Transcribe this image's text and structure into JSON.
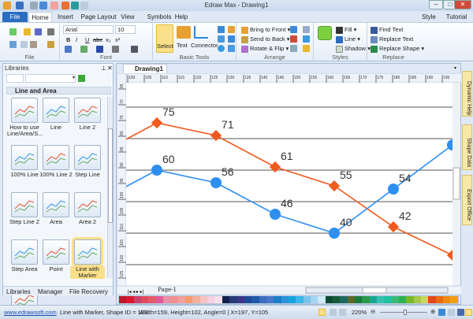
{
  "window": {
    "title": "Edraw Max - Drawing1",
    "style": "Style",
    "tutorial": "Tutorial"
  },
  "tabs": [
    "File",
    "Home",
    "Insert",
    "Page Layout",
    "View",
    "Symbols",
    "Help"
  ],
  "ribbon": {
    "file_group": "File",
    "font": {
      "name": "Arial",
      "size": "10",
      "label": "Font",
      "bold": "B",
      "italic": "I",
      "underline": "U",
      "strike": "abc",
      "sub": "x₂",
      "sup": "x²"
    },
    "basic_tools": {
      "label": "Basic Tools",
      "select": "Select",
      "text": "Text",
      "connector": "Connector"
    },
    "arrange": {
      "label": "Arrange",
      "bring_front": "Bring to Front",
      "send_back": "Send to Back",
      "rotate": "Rotate & Flip"
    },
    "styles": {
      "label": "Styles",
      "fill": "Fill",
      "line": "Line",
      "shadow": "Shadow"
    },
    "replace": {
      "label": "Replace",
      "find": "Find Text",
      "replace_text": "Replace Text",
      "replace_shape": "Replace Shape"
    }
  },
  "libraries": {
    "title": "Libraries",
    "category": "Line and Area",
    "items": [
      "How to use Line/Area/S...",
      "Line",
      "Line 2",
      "100% Line",
      "100% Line 2",
      "Step Line",
      "Step Line 2",
      "Area",
      "Area 2",
      "Step Area",
      "Point",
      "Line with Marker",
      ""
    ],
    "selected": "Line with Marker",
    "bottom_tabs": [
      "Libraries",
      "Manager",
      "File Recovery"
    ]
  },
  "document_tab": "Drawing1",
  "ruler": {
    "h": [
      "100",
      "105",
      "110",
      "115",
      "120",
      "125",
      "130",
      "135",
      "140",
      "145",
      "150",
      "155",
      "160",
      "165",
      "170",
      "175",
      "180",
      "185",
      "190",
      "195"
    ],
    "v": [
      "65",
      "70",
      "75",
      "80",
      "85",
      "90",
      "95",
      "100",
      "105",
      "110",
      "115",
      "120",
      "125"
    ]
  },
  "page_tab": "Page-1",
  "right_panel": [
    "Dynamic Help",
    "Shape Data",
    "Export Office"
  ],
  "palette": [
    "#c0162b",
    "#d9182f",
    "#c9426a",
    "#e04b5e",
    "#e45c6a",
    "#e05a9a",
    "#e890a8",
    "#ef8f8f",
    "#f2a0a0",
    "#f79a6e",
    "#f4b09a",
    "#f6c2c2",
    "#f5d0e0",
    "#fbe0ea",
    "#14204e",
    "#263a78",
    "#3c3488",
    "#1e4b96",
    "#1e5aa8",
    "#3a6cc0",
    "#4a78c8",
    "#1a7ec8",
    "#2a94d8",
    "#19a4e0",
    "#39b6ea",
    "#7ac4ec",
    "#a4d4f0",
    "#cfe8f6",
    "#0b4a30",
    "#145c3a",
    "#1e6a60",
    "#5a6a2a",
    "#1a7a3a",
    "#2a9a4a",
    "#17a894",
    "#3ac0b0",
    "#20c0a0",
    "#3ab878",
    "#30b050",
    "#7ab828",
    "#a8c848",
    "#c8d860",
    "#e04a1a",
    "#ea6a10",
    "#f08a10",
    "#f0a010"
  ],
  "chart_data": {
    "type": "line",
    "title": "",
    "xlabel": "",
    "ylabel": "",
    "ylim": [
      20,
      95
    ],
    "grid": true,
    "x": [
      0,
      1,
      2,
      3,
      4,
      5,
      6
    ],
    "series": [
      {
        "name": "Series 1",
        "color": "#f05a1e",
        "marker": "diamond",
        "values": [
          65,
          75,
          71,
          61,
          55,
          42,
          33
        ],
        "labels": [
          "",
          "75",
          "71",
          "61",
          "55",
          "42",
          ""
        ]
      },
      {
        "name": "Series 2",
        "color": "#2e8ff0",
        "marker": "circle",
        "values": [
          50,
          60,
          56,
          46,
          40,
          54,
          68
        ],
        "labels": [
          "",
          "60",
          "56",
          "46",
          "40",
          "54",
          ""
        ]
      }
    ],
    "gridlines": [
      80,
      70,
      60,
      50,
      40,
      30
    ]
  },
  "status": {
    "link": "www.edrawsoft.com",
    "shape": "Line with Marker, Shape ID = 103",
    "geometry": "Width=159, Height=102, Angle=0 | X=197, Y=105",
    "zoom": "220%"
  }
}
